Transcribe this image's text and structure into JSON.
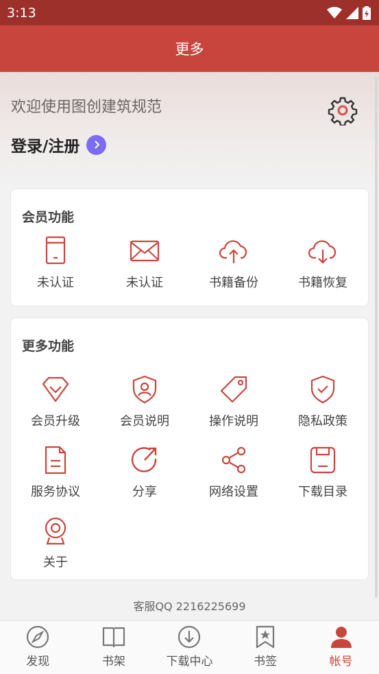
{
  "status_bar": {
    "time": "3:13"
  },
  "app_bar": {
    "title": "更多"
  },
  "header": {
    "welcome": "欢迎使用图创建筑规范",
    "login": "登录/注册"
  },
  "member_section": {
    "title": "会员功能",
    "items": [
      {
        "label": "未认证",
        "icon": "phone-icon"
      },
      {
        "label": "未认证",
        "icon": "mail-icon"
      },
      {
        "label": "书籍备份",
        "icon": "cloud-upload-icon"
      },
      {
        "label": "书籍恢复",
        "icon": "cloud-download-icon"
      }
    ]
  },
  "more_section": {
    "title": "更多功能",
    "items": [
      {
        "label": "会员升级",
        "icon": "diamond-icon"
      },
      {
        "label": "会员说明",
        "icon": "user-shield-icon"
      },
      {
        "label": "操作说明",
        "icon": "tag-icon"
      },
      {
        "label": "隐私政策",
        "icon": "shield-check-icon"
      },
      {
        "label": "服务协议",
        "icon": "document-icon"
      },
      {
        "label": "分享",
        "icon": "share-arrow-icon"
      },
      {
        "label": "网络设置",
        "icon": "share-nodes-icon"
      },
      {
        "label": "下载目录",
        "icon": "save-icon"
      },
      {
        "label": "关于",
        "icon": "webcam-icon"
      }
    ]
  },
  "service": "客服QQ 2216225699",
  "tabs": [
    {
      "label": "发现",
      "icon": "compass-icon",
      "active": false
    },
    {
      "label": "书架",
      "icon": "book-icon",
      "active": false
    },
    {
      "label": "下载中心",
      "icon": "download-icon",
      "active": false
    },
    {
      "label": "书签",
      "icon": "bookmark-icon",
      "active": false
    },
    {
      "label": "帐号",
      "icon": "person-icon",
      "active": true
    }
  ],
  "colors": {
    "brand": "#c8453d",
    "status_bar": "#9e302b",
    "accent": "#7b6cf0"
  }
}
